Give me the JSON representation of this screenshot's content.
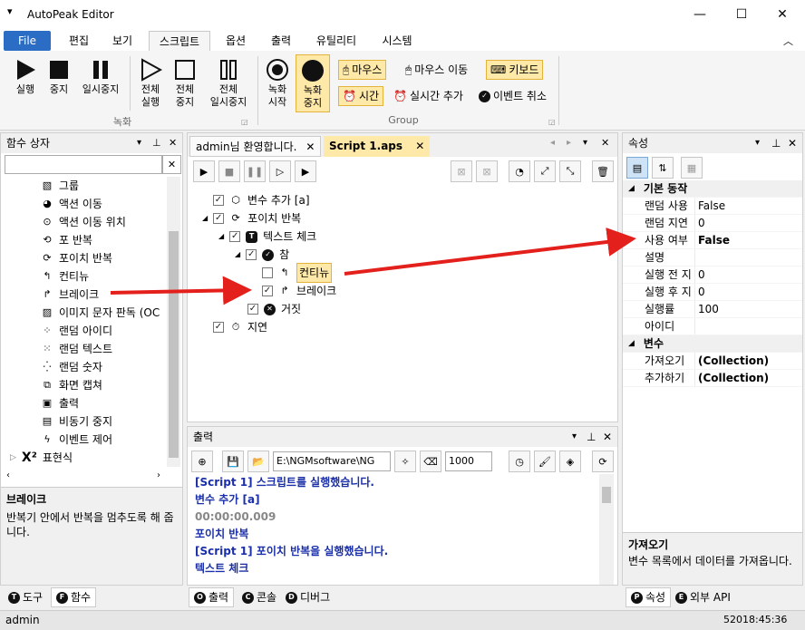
{
  "window": {
    "title": "AutoPeak Editor",
    "min_glyph": "—",
    "max_glyph": "☐",
    "close_glyph": "✕"
  },
  "menu": {
    "tabs": [
      "File",
      "편집",
      "보기",
      "스크립트",
      "옵션",
      "출력",
      "유틸리티",
      "시스템"
    ]
  },
  "ribbon": {
    "record_group": "녹화",
    "group_group": "Group",
    "buttons": [
      [
        "실행"
      ],
      [
        "중지"
      ],
      [
        "일시중지"
      ],
      [
        "전체",
        "실행"
      ],
      [
        "전체",
        "중지"
      ],
      [
        "전체",
        "일시중지"
      ],
      [
        "녹화",
        "시작"
      ],
      [
        "녹화",
        "중지"
      ]
    ],
    "chips": {
      "mouse": "마우스",
      "mouse_move": "마우스 이동",
      "keyboard": "키보드",
      "time": "시간",
      "realtime_add": "실시간 추가",
      "event_cancel": "이벤트 취소"
    }
  },
  "func_panel": {
    "title": "함수 상자",
    "items": [
      "그룹",
      "액션 이동",
      "액션 이동 위치",
      "포 반복",
      "포이치 반복",
      "컨티뉴",
      "브레이크",
      "이미지 문자 판독 (OC",
      "랜덤 아이디",
      "랜덤 텍스트",
      "랜덤 숫자",
      "화면 캡쳐",
      "출력",
      "비동기 중지",
      "이벤트 제어",
      "표현식"
    ],
    "desc_title": "브레이크",
    "desc_text": "반복기 안에서 반복을 멈추도록 해 줍니다.",
    "tabs": [
      "도구",
      "함수"
    ]
  },
  "editor": {
    "tabs": [
      "admin님 환영합니다.",
      "Script 1.aps"
    ],
    "tree": [
      "변수 추가 [a]",
      "포이치 반복",
      "텍스트 체크",
      "참",
      "컨티뉴",
      "브레이크",
      "거짓",
      "지연"
    ]
  },
  "output": {
    "title": "출력",
    "path": "E:\\NGMsoftware\\NG",
    "count": "1000",
    "lines": [
      {
        "text": "[Script 1] 스크립트를 실행했습니다.",
        "color": "#1a2fa8"
      },
      {
        "text": "변수 추가 [a]",
        "color": "#1a2fa8"
      },
      {
        "text": "00:00:00.009",
        "color": "#888888"
      },
      {
        "text": "포이치 반복",
        "color": "#1a2fa8"
      },
      {
        "text": "[Script 1] 포이치 반복을 실행했습니다.",
        "color": "#1a2fa8"
      },
      {
        "text": "텍스트 체크",
        "color": "#1a2fa8"
      }
    ],
    "tabs": [
      "출력",
      "콘솔",
      "디버그"
    ]
  },
  "props": {
    "title": "속성",
    "sec_basic": "기본 동작",
    "rows": [
      [
        "랜덤 사용",
        "False"
      ],
      [
        "랜덤 지연",
        "0"
      ],
      [
        "사용 여부",
        "False"
      ],
      [
        "설명",
        ""
      ],
      [
        "실행 전 지",
        "0"
      ],
      [
        "실행 후 지",
        "0"
      ],
      [
        "실행률",
        "100"
      ],
      [
        "아이디",
        ""
      ]
    ],
    "sec_var": "변수",
    "var_rows": [
      [
        "가져오기",
        "(Collection)"
      ],
      [
        "추가하기",
        "(Collection)"
      ]
    ],
    "desc_title": "가져오기",
    "desc_text": "변수 목록에서 데이터를 가져옵니다.",
    "tabs": [
      "속성",
      "외부 API"
    ]
  },
  "status": {
    "user": "admin",
    "time": "52018:45:36"
  },
  "colors": {
    "accent": "#2b6cc4",
    "arrow": "#e3201b",
    "highlight": "#ffe9a8"
  }
}
